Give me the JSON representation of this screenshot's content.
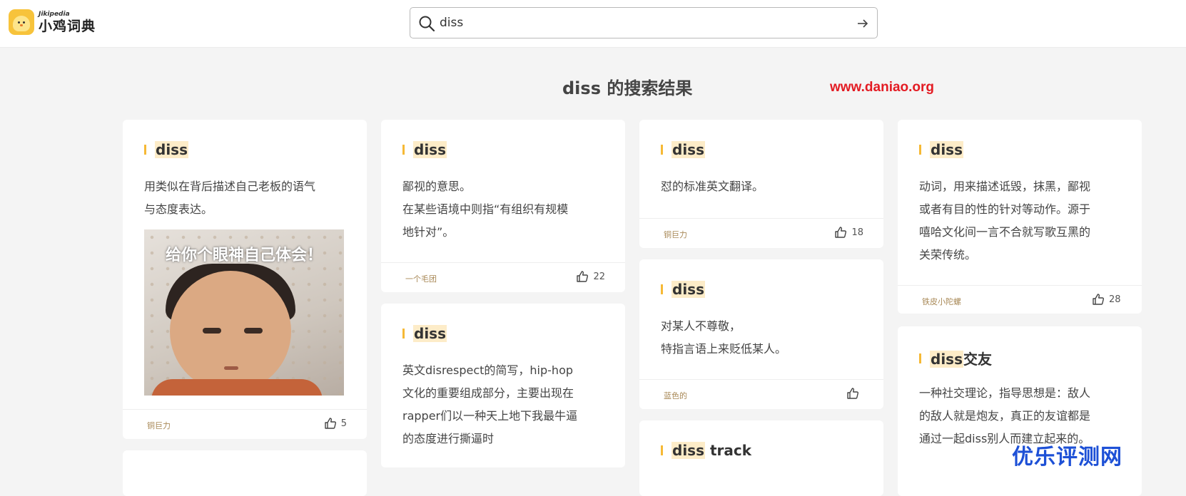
{
  "header": {
    "logo_en": "Jikipedia",
    "logo_cn": "小鸡词典",
    "search_value": "diss"
  },
  "result_title": "diss 的搜索结果",
  "watermarks": {
    "url": "www.daniao.org",
    "brand": "优乐评测网"
  },
  "cards": [
    {
      "word": "diss",
      "definition": [
        "用类似在背后描述自己老板的语气",
        "与态度表达。"
      ],
      "meme_caption": "给你个眼神自己体会！",
      "author": "铜巨力",
      "likes": "5"
    },
    {
      "word": "diss",
      "definition": [
        "鄙视的意思。",
        "在某些语境中则指“有组织有规模",
        "地针对”。"
      ],
      "author": "一个毛团",
      "likes": "22"
    },
    {
      "word": "diss",
      "definition": [
        "英文disrespect的简写，hip-hop",
        "文化的重要组成部分，主要出现在",
        "rapper们以一种天上地下我最牛逼",
        "的态度进行撕逼时"
      ]
    },
    {
      "word": "diss",
      "definition": [
        "怼的标准英文翻译。"
      ],
      "author": "铜巨力",
      "likes": "18"
    },
    {
      "word": "diss",
      "definition": [
        "对某人不尊敬，",
        "特指言语上来贬低某人。"
      ],
      "author": "蓝色的",
      "likes": ""
    },
    {
      "word": "diss track",
      "word_hl": "diss",
      "word_rest": " track"
    },
    {
      "word": "diss",
      "definition": [
        "动词，用来描述诋毁，抹黑，鄙视",
        "或者有目的性的针对等动作。源于",
        "嘻哈文化间一言不合就写歌互黑的",
        "关荣传统。"
      ],
      "author": "铁皮小陀螺",
      "likes": "28"
    },
    {
      "word": "diss交友",
      "word_hl": "diss",
      "word_rest": "交友",
      "definition": [
        "一种社交理论，指导思想是：敌人",
        "的敌人就是炮友，真正的友谊都是",
        "通过一起diss别人而建立起来的。"
      ]
    }
  ],
  "colors": {
    "accent": "#f6b936",
    "highlight": "#fdecc8",
    "author": "#a88856",
    "watermark_red": "#e31b23",
    "watermark_blue": "#1d50d6"
  },
  "icons": [
    "search-icon",
    "arrow-right-icon",
    "thumbs-up-icon"
  ]
}
